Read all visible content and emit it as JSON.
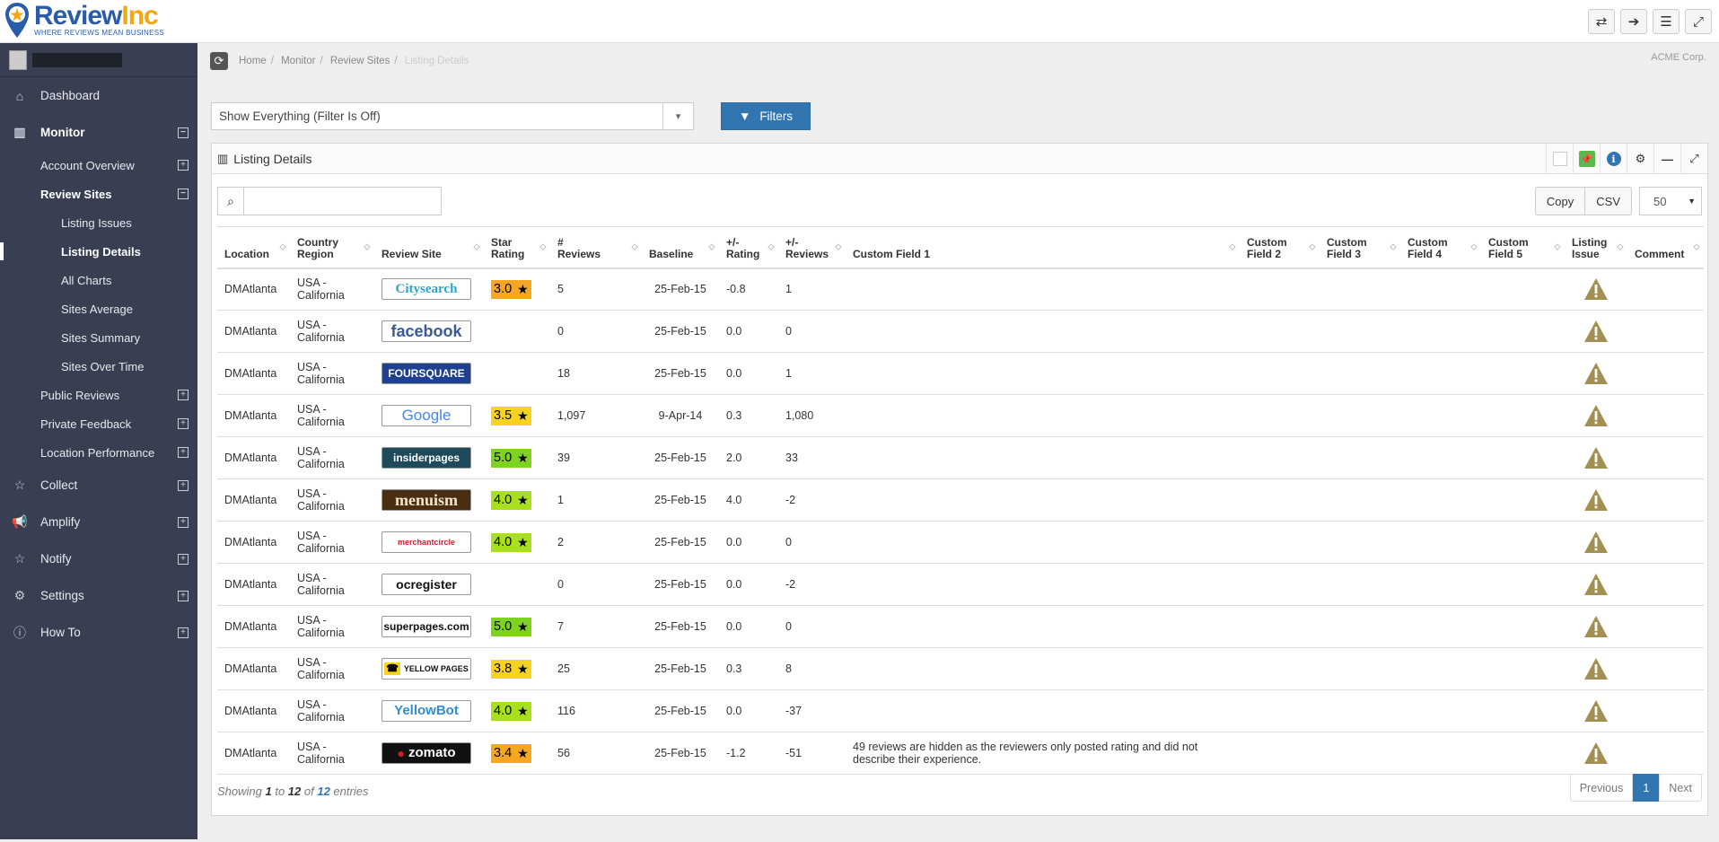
{
  "brand": {
    "name_part1": "Review",
    "name_part2": "Inc",
    "tagline": "WHERE REVIEWS MEAN BUSINESS",
    "colors": {
      "primary": "#2a5caa",
      "accent": "#f3a712"
    }
  },
  "topbar_buttons": [
    {
      "name": "switch-icon",
      "glyph": "⇄"
    },
    {
      "name": "logout-icon",
      "glyph": "➔"
    },
    {
      "name": "menu-icon",
      "glyph": "☰"
    },
    {
      "name": "fullscreen-icon",
      "glyph": "⤢"
    }
  ],
  "sidebar": {
    "items": [
      {
        "label": "Dashboard",
        "icon": "home-icon",
        "glyph": "⌂",
        "level": "top",
        "expand": ""
      },
      {
        "label": "Monitor",
        "icon": "bar-chart-icon",
        "glyph": "▥",
        "level": "top",
        "expand": "−",
        "bold": true
      },
      {
        "label": "Account Overview",
        "level": "sub",
        "expand": "+"
      },
      {
        "label": "Review Sites",
        "level": "sub",
        "expand": "−",
        "bold": true
      },
      {
        "label": "Listing Issues",
        "level": "subsub"
      },
      {
        "label": "Listing Details",
        "level": "subsub",
        "bold": true,
        "active": true
      },
      {
        "label": "All Charts",
        "level": "subsub"
      },
      {
        "label": "Sites Average",
        "level": "subsub"
      },
      {
        "label": "Sites Summary",
        "level": "subsub"
      },
      {
        "label": "Sites Over Time",
        "level": "subsub"
      },
      {
        "label": "Public Reviews",
        "level": "sub",
        "expand": "+"
      },
      {
        "label": "Private Feedback",
        "level": "sub",
        "expand": "+"
      },
      {
        "label": "Location Performance",
        "level": "sub",
        "expand": "+"
      },
      {
        "label": "Collect",
        "icon": "star-icon",
        "glyph": "☆",
        "level": "top",
        "expand": "+"
      },
      {
        "label": "Amplify",
        "icon": "megaphone-icon",
        "glyph": "📢",
        "level": "top",
        "expand": "+"
      },
      {
        "label": "Notify",
        "icon": "star-icon",
        "glyph": "☆",
        "level": "top",
        "expand": "+"
      },
      {
        "label": "Settings",
        "icon": "cogs-icon",
        "glyph": "⚙",
        "level": "top",
        "expand": "+"
      },
      {
        "label": "How To",
        "icon": "info-icon",
        "glyph": "ⓘ",
        "level": "top",
        "expand": "+"
      }
    ]
  },
  "breadcrumb": [
    "Home",
    "Monitor",
    "Review Sites",
    "Listing Details"
  ],
  "company": "ACME Corp.",
  "filter": {
    "select_value": "Show Everything (Filter Is Off)",
    "button_label": "Filters"
  },
  "panel": {
    "title": "Listing Details"
  },
  "toolbar": {
    "search_value": "",
    "copy_label": "Copy",
    "csv_label": "CSV",
    "page_length": "50"
  },
  "table": {
    "columns": [
      {
        "l1": "",
        "l2": "Location"
      },
      {
        "l1": "Country",
        "l2": "Region"
      },
      {
        "l1": "",
        "l2": "Review Site"
      },
      {
        "l1": "Star",
        "l2": "Rating"
      },
      {
        "l1": "#",
        "l2": "Reviews"
      },
      {
        "l1": "",
        "l2": "Baseline"
      },
      {
        "l1": "+/-",
        "l2": "Rating"
      },
      {
        "l1": "+/-",
        "l2": "Reviews"
      },
      {
        "l1": "",
        "l2": "Custom Field 1"
      },
      {
        "l1": "Custom",
        "l2": "Field 2"
      },
      {
        "l1": "Custom",
        "l2": "Field 3"
      },
      {
        "l1": "Custom",
        "l2": "Field 4"
      },
      {
        "l1": "Custom",
        "l2": "Field 5"
      },
      {
        "l1": "Listing",
        "l2": "Issue"
      },
      {
        "l1": "",
        "l2": "Comment"
      }
    ],
    "rows": [
      {
        "location": "DMAtlanta",
        "region1": "USA -",
        "region2": "California",
        "site": "Citysearch",
        "rating": "3.0",
        "rating_color": "#f5a623",
        "reviews": "5",
        "baseline": "25-Feb-15",
        "delta_rating": "-0.8",
        "delta_reviews": "1",
        "custom1": ""
      },
      {
        "location": "DMAtlanta",
        "region1": "USA -",
        "region2": "California",
        "site": "facebook",
        "rating": "",
        "rating_color": "",
        "reviews": "0",
        "baseline": "25-Feb-15",
        "delta_rating": "0.0",
        "delta_reviews": "0",
        "custom1": ""
      },
      {
        "location": "DMAtlanta",
        "region1": "USA -",
        "region2": "California",
        "site": "FOURSQUARE",
        "rating": "",
        "rating_color": "",
        "reviews": "18",
        "baseline": "25-Feb-15",
        "delta_rating": "0.0",
        "delta_reviews": "1",
        "custom1": ""
      },
      {
        "location": "DMAtlanta",
        "region1": "USA -",
        "region2": "California",
        "site": "Google",
        "rating": "3.5",
        "rating_color": "#f7d21e",
        "reviews": "1,097",
        "baseline": "9-Apr-14",
        "delta_rating": "0.3",
        "delta_reviews": "1,080",
        "custom1": ""
      },
      {
        "location": "DMAtlanta",
        "region1": "USA -",
        "region2": "California",
        "site": "insiderpages",
        "rating": "5.0",
        "rating_color": "#7ed321",
        "reviews": "39",
        "baseline": "25-Feb-15",
        "delta_rating": "2.0",
        "delta_reviews": "33",
        "custom1": ""
      },
      {
        "location": "DMAtlanta",
        "region1": "USA -",
        "region2": "California",
        "site": "menuism",
        "rating": "4.0",
        "rating_color": "#a8e01e",
        "reviews": "1",
        "baseline": "25-Feb-15",
        "delta_rating": "4.0",
        "delta_reviews": "-2",
        "custom1": ""
      },
      {
        "location": "DMAtlanta",
        "region1": "USA -",
        "region2": "California",
        "site": "merchantcircle",
        "rating": "4.0",
        "rating_color": "#a8e01e",
        "reviews": "2",
        "baseline": "25-Feb-15",
        "delta_rating": "0.0",
        "delta_reviews": "0",
        "custom1": ""
      },
      {
        "location": "DMAtlanta",
        "region1": "USA -",
        "region2": "California",
        "site": "ocregister",
        "rating": "",
        "rating_color": "",
        "reviews": "0",
        "baseline": "25-Feb-15",
        "delta_rating": "0.0",
        "delta_reviews": "-2",
        "custom1": ""
      },
      {
        "location": "DMAtlanta",
        "region1": "USA -",
        "region2": "California",
        "site": "superpages.com",
        "rating": "5.0",
        "rating_color": "#7ed321",
        "reviews": "7",
        "baseline": "25-Feb-15",
        "delta_rating": "0.0",
        "delta_reviews": "0",
        "custom1": ""
      },
      {
        "location": "DMAtlanta",
        "region1": "USA -",
        "region2": "California",
        "site": "YELLOW PAGES",
        "rating": "3.8",
        "rating_color": "#f7d21e",
        "reviews": "25",
        "baseline": "25-Feb-15",
        "delta_rating": "0.3",
        "delta_reviews": "8",
        "custom1": ""
      },
      {
        "location": "DMAtlanta",
        "region1": "USA -",
        "region2": "California",
        "site": "YellowBot",
        "rating": "4.0",
        "rating_color": "#a8e01e",
        "reviews": "116",
        "baseline": "25-Feb-15",
        "delta_rating": "0.0",
        "delta_reviews": "-37",
        "custom1": ""
      },
      {
        "location": "DMAtlanta",
        "region1": "USA -",
        "region2": "California",
        "site": "zomato",
        "rating": "3.4",
        "rating_color": "#f5a623",
        "reviews": "56",
        "baseline": "25-Feb-15",
        "delta_rating": "-1.2",
        "delta_reviews": "-51",
        "custom1": "49 reviews are hidden as the reviewers only posted rating and did not describe their experience."
      }
    ]
  },
  "footer": {
    "showing_prefix": "Showing ",
    "from": "1",
    "to_word": " to ",
    "to": "12",
    "of_word": " of ",
    "total": "12",
    "suffix": " entries"
  },
  "pagination": {
    "previous": "Previous",
    "current": "1",
    "next": "Next"
  }
}
